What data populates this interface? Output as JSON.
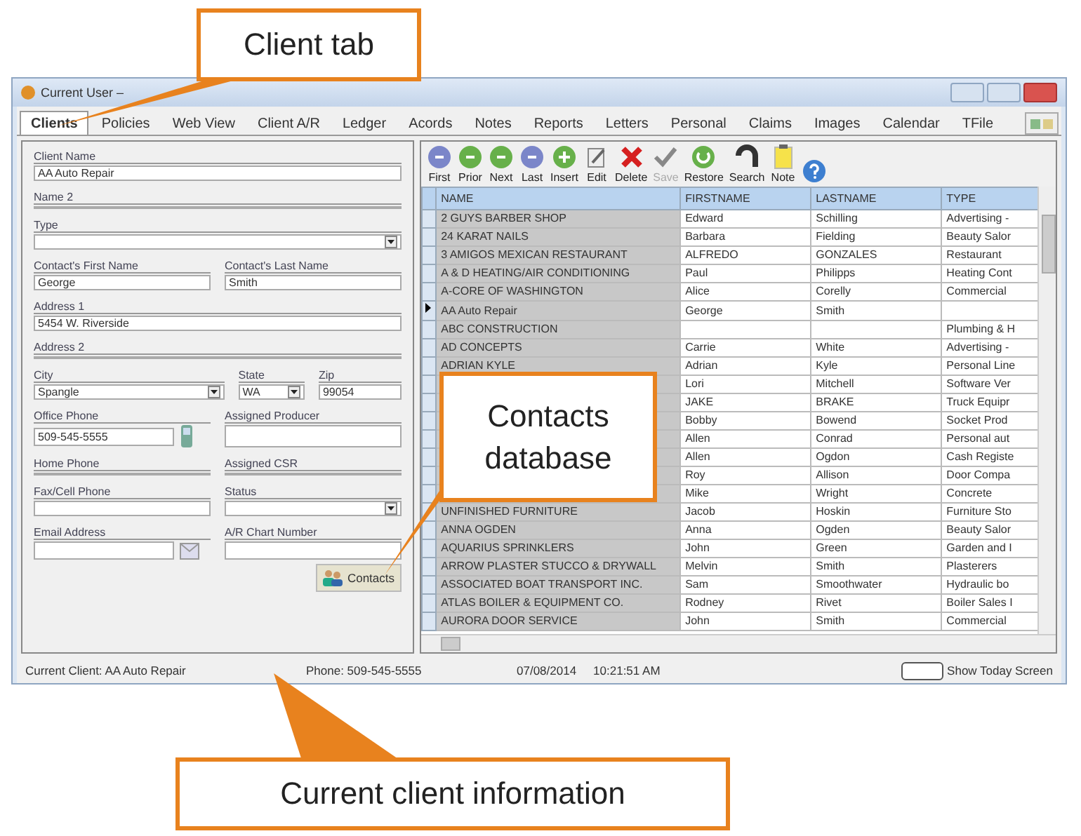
{
  "window": {
    "title": "Current User –"
  },
  "tabs": [
    {
      "label": "Clients",
      "selected": true
    },
    {
      "label": "Policies",
      "selected": false
    },
    {
      "label": "Web View",
      "selected": false
    },
    {
      "label": "Client A/R",
      "selected": false
    },
    {
      "label": "Ledger",
      "selected": false
    },
    {
      "label": "Acords",
      "selected": false
    },
    {
      "label": "Notes",
      "selected": false
    },
    {
      "label": "Reports",
      "selected": false
    },
    {
      "label": "Letters",
      "selected": false
    },
    {
      "label": "Personal",
      "selected": false
    },
    {
      "label": "Claims",
      "selected": false
    },
    {
      "label": "Images",
      "selected": false
    },
    {
      "label": "Calendar",
      "selected": false
    },
    {
      "label": "TFile",
      "selected": false
    }
  ],
  "form": {
    "rows": [
      [
        {
          "label": "Client Name",
          "kind": "text",
          "value": "AA Auto Repair"
        }
      ],
      [
        {
          "label": "Name 2",
          "kind": "text"
        }
      ],
      [
        {
          "label": "Type",
          "kind": "dropdown"
        }
      ],
      [
        {
          "label": "Contact's First Name",
          "kind": "text",
          "value": "George"
        },
        {
          "label": "Contact's Last Name",
          "kind": "text",
          "value": "Smith"
        }
      ],
      [
        {
          "label": "Address 1",
          "kind": "text",
          "value": "5454 W. Riverside"
        }
      ],
      [
        {
          "label": "Address 2",
          "kind": "text"
        }
      ],
      [
        {
          "label": "City",
          "kind": "dropdown",
          "value": "Spangle"
        },
        {
          "label": "State",
          "kind": "dropdown",
          "value": "WA"
        },
        {
          "label": "Zip",
          "kind": "text",
          "value": "99054"
        }
      ],
      [
        {
          "label": "Office Phone",
          "kind": "phone",
          "value": "509-545-5555"
        },
        {
          "label": "Assigned Producer",
          "kind": "text"
        }
      ],
      [
        {
          "label": "Home Phone",
          "kind": "text"
        },
        {
          "label": "Assigned CSR",
          "kind": "text"
        }
      ],
      [
        {
          "label": "Fax/Cell Phone",
          "kind": "text"
        },
        {
          "label": "Status",
          "kind": "dropdown"
        }
      ],
      [
        {
          "label": "Email Address",
          "kind": "email"
        },
        {
          "label": "A/R Chart Number",
          "kind": "text"
        }
      ]
    ],
    "contacts_button": {
      "label": "Contacts"
    }
  },
  "toolbar": [
    {
      "kind": "blue",
      "label": "First",
      "disabled": false
    },
    {
      "kind": "green",
      "label": "Prior",
      "disabled": false
    },
    {
      "kind": "green",
      "label": "Next",
      "disabled": false
    },
    {
      "kind": "blue",
      "label": "Last",
      "disabled": false
    },
    {
      "kind": "plus",
      "label": "Insert",
      "disabled": false
    },
    {
      "kind": "edit",
      "label": "Edit",
      "disabled": false
    },
    {
      "kind": "delete",
      "label": "Delete",
      "disabled": false
    },
    {
      "kind": "check",
      "label": "Save",
      "disabled": true
    },
    {
      "kind": "restore",
      "label": "Restore",
      "disabled": false
    },
    {
      "kind": "search",
      "label": "Search",
      "disabled": false
    },
    {
      "kind": "note",
      "label": "Note",
      "disabled": false
    },
    {
      "kind": "help"
    }
  ],
  "table": {
    "columns": [
      "NAME",
      "FIRSTNAME",
      "LASTNAME",
      "TYPE"
    ],
    "rows": [
      {
        "selected": false,
        "name": "2 GUYS BARBER SHOP",
        "firstname": "Edward",
        "lastname": "Schilling",
        "type": "Advertising -"
      },
      {
        "selected": false,
        "name": "24 KARAT NAILS",
        "firstname": "Barbara",
        "lastname": "Fielding",
        "type": "Beauty Salor"
      },
      {
        "selected": false,
        "name": "3 AMIGOS MEXICAN RESTAURANT",
        "firstname": "ALFREDO",
        "lastname": "GONZALES",
        "type": "Restaurant"
      },
      {
        "selected": false,
        "name": "A & D HEATING/AIR CONDITIONING",
        "firstname": "Paul",
        "lastname": "Philipps",
        "type": "Heating Cont"
      },
      {
        "selected": false,
        "name": "A-CORE OF WASHINGTON",
        "firstname": "Alice",
        "lastname": "Corelly",
        "type": "Commercial"
      },
      {
        "selected": true,
        "name": "AA Auto Repair",
        "firstname": "George",
        "lastname": "Smith"
      },
      {
        "selected": false,
        "name": "ABC CONSTRUCTION",
        "type": "Plumbing & H"
      },
      {
        "selected": false,
        "name": "AD CONCEPTS",
        "firstname": "Carrie",
        "lastname": "White",
        "type": "Advertising -"
      },
      {
        "selected": false,
        "name": "ADRIAN KYLE",
        "firstname": "Adrian",
        "lastname": "Kyle",
        "type": "Personal Line"
      },
      {
        "selected": false,
        "firstname": "Lori",
        "lastname": "Mitchell",
        "type": "Software Ver"
      },
      {
        "selected": false,
        "firstname": "JAKE",
        "lastname": "BRAKE",
        "type": "Truck Equipr"
      },
      {
        "selected": false,
        "firstname": "Bobby",
        "lastname": "Bowend",
        "type": "Socket Prod"
      },
      {
        "selected": false,
        "firstname": "Allen",
        "lastname": "Conrad",
        "type": "Personal aut"
      },
      {
        "selected": false,
        "firstname": "Allen",
        "lastname": "Ogdon",
        "type": "Cash Registe"
      },
      {
        "selected": false,
        "firstname": "Roy",
        "lastname": "Allison",
        "type": "Door Compa"
      },
      {
        "selected": false,
        "firstname": "Mike",
        "lastname": "Wright",
        "type": "Concrete"
      },
      {
        "selected": false,
        "name": "UNFINISHED FURNITURE",
        "firstname": "Jacob",
        "lastname": "Hoskin",
        "type": "Furniture Sto"
      },
      {
        "selected": false,
        "name": "ANNA OGDEN",
        "firstname": "Anna",
        "lastname": "Ogden",
        "type": "Beauty Salor"
      },
      {
        "selected": false,
        "name": "AQUARIUS SPRINKLERS",
        "firstname": "John",
        "lastname": "Green",
        "type": "Garden and I"
      },
      {
        "selected": false,
        "name": "ARROW PLASTER STUCCO & DRYWALL",
        "firstname": "Melvin",
        "lastname": "Smith",
        "type": "Plasterers"
      },
      {
        "selected": false,
        "name": "ASSOCIATED BOAT TRANSPORT INC.",
        "firstname": "Sam",
        "lastname": "Smoothwater",
        "type": "Hydraulic bo"
      },
      {
        "selected": false,
        "name": "ATLAS BOILER & EQUIPMENT CO.",
        "firstname": "Rodney",
        "lastname": "Rivet",
        "type": "Boiler Sales I"
      },
      {
        "selected": false,
        "name": "AURORA DOOR SERVICE",
        "firstname": "John",
        "lastname": "Smith",
        "type": "Commercial"
      }
    ]
  },
  "status_bar": {
    "client": "Current Client: AA Auto Repair",
    "phone": "Phone: 509-545-5555",
    "date": "07/08/2014",
    "time": "10:21:51 AM",
    "today_label": "Show Today Screen"
  },
  "callouts": [
    {
      "text": "Client tab"
    },
    {
      "text": "Contacts database"
    },
    {
      "text": "Current client information"
    }
  ]
}
